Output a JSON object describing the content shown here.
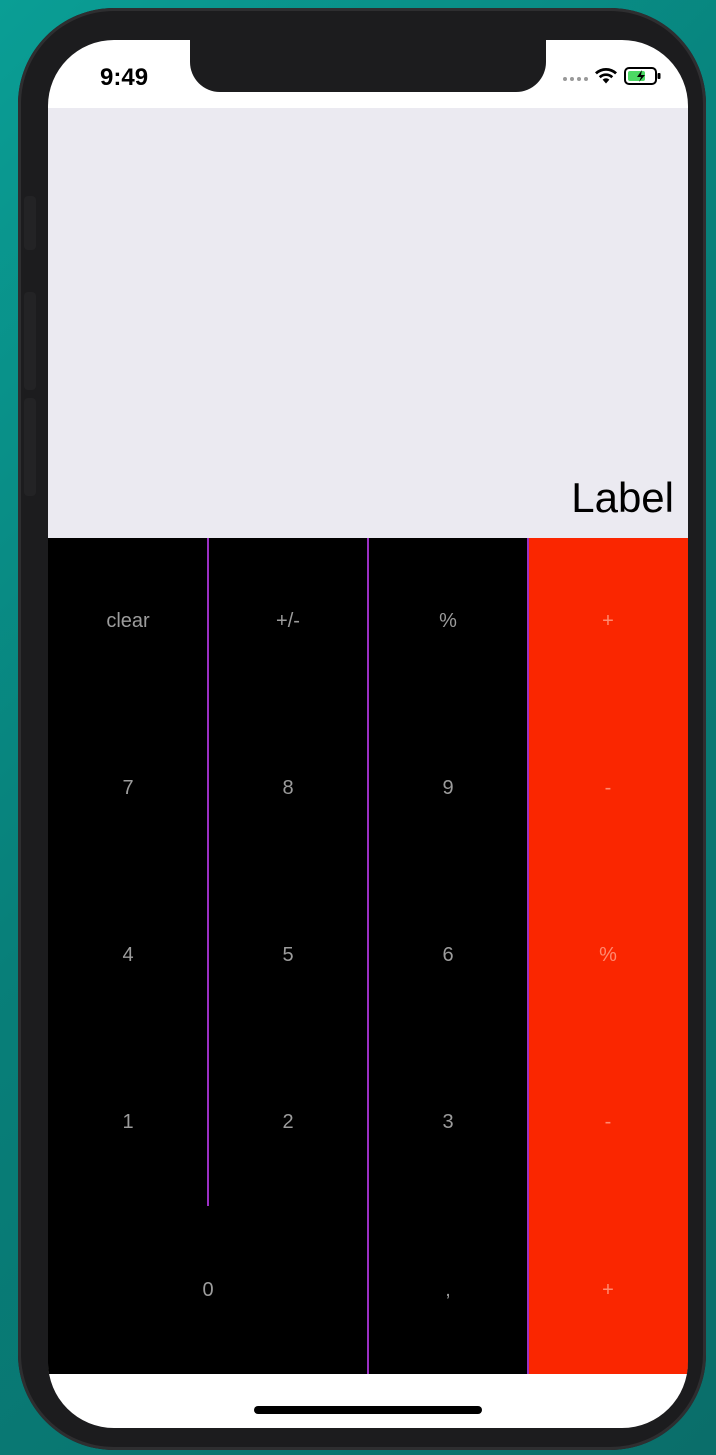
{
  "status_bar": {
    "time": "9:49"
  },
  "display": {
    "label": "Label"
  },
  "keypad": {
    "row1": [
      "clear",
      "+/-",
      "%",
      "+"
    ],
    "row2": [
      "7",
      "8",
      "9",
      "-"
    ],
    "row3": [
      "4",
      "5",
      "6",
      "%"
    ],
    "row4": [
      "1",
      "2",
      "3",
      "-"
    ],
    "row5": [
      "0",
      ",",
      "+"
    ]
  },
  "colors": {
    "display_bg": "#ebeaf1",
    "keypad_bg": "#000000",
    "operator_bg": "#fa2600",
    "divider": "#9b30c4",
    "key_text": "#9c9c9c",
    "device_bezel": "#1c1c1e",
    "background": "#0a9e95"
  },
  "icons": [
    "wifi-icon",
    "battery-charging-icon",
    "cellular-signal-icon"
  ]
}
